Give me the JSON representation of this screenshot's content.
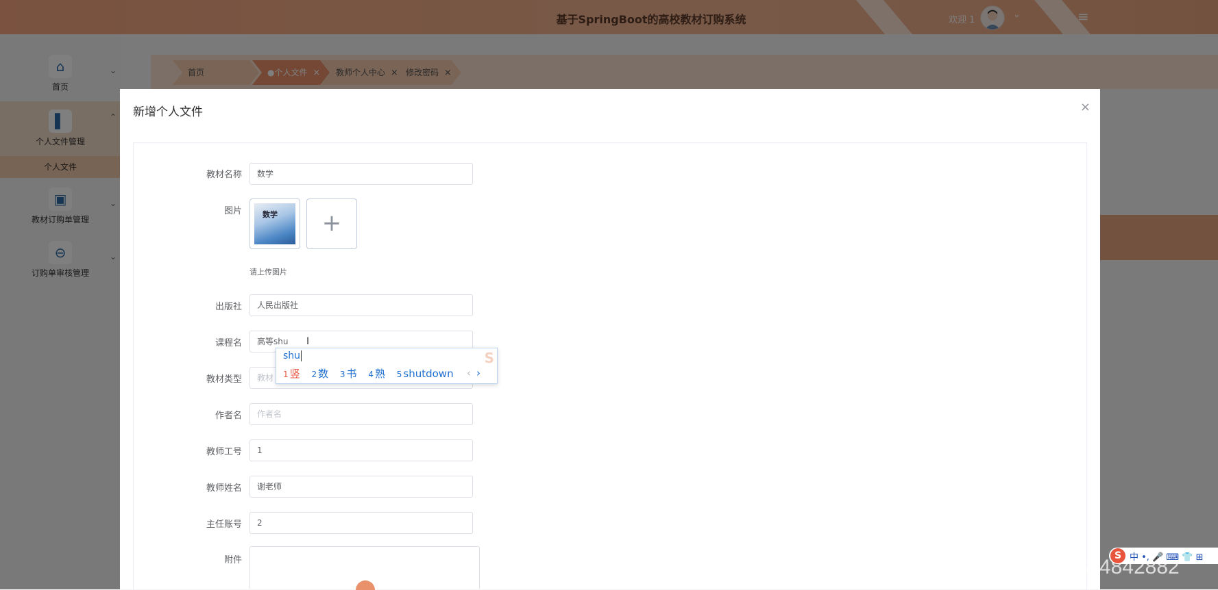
{
  "header": {
    "title": "基于SpringBoot的高校教材订购系统",
    "welcome": "欢迎 1",
    "chevron": "⌄",
    "menu_icon": "≡"
  },
  "sidebar": {
    "items": [
      {
        "label": "首页",
        "icon": "home-icon"
      },
      {
        "label": "个人文件管理",
        "icon": "file-panel-icon",
        "sub": "个人文件"
      },
      {
        "label": "教材订购单管理",
        "icon": "briefcase-icon"
      },
      {
        "label": "订购单审核管理",
        "icon": "audit-icon"
      }
    ]
  },
  "tabs": [
    {
      "label": "首页"
    },
    {
      "label": "●个人文件",
      "close": "×"
    },
    {
      "label": "教师个人中心",
      "close": "×"
    },
    {
      "label": "修改密码",
      "close": "×"
    }
  ],
  "dialog": {
    "title": "新增个人文件",
    "close": "×",
    "fields": {
      "textbook_name": {
        "label": "教材名称",
        "value": "数学"
      },
      "image": {
        "label": "图片",
        "hint": "请上传图片",
        "thumb_text": "数学",
        "plus": "+"
      },
      "publisher": {
        "label": "出版社",
        "value": "人民出版社"
      },
      "course": {
        "label": "课程名",
        "value": "高等shu"
      },
      "textbook_type": {
        "label": "教材类型",
        "placeholder": "教材"
      },
      "author": {
        "label": "作者名",
        "placeholder": "作者名"
      },
      "teacher_id": {
        "label": "教师工号",
        "value": "1"
      },
      "teacher_name": {
        "label": "教师姓名",
        "value": "谢老师"
      },
      "director_account": {
        "label": "主任账号",
        "value": "2"
      },
      "attachment": {
        "label": "附件"
      }
    }
  },
  "ime": {
    "composition": "shu",
    "candidates": [
      {
        "n": "1",
        "text": "竖"
      },
      {
        "n": "2",
        "text": "数"
      },
      {
        "n": "3",
        "text": "书"
      },
      {
        "n": "4",
        "text": "熟"
      },
      {
        "n": "5",
        "text": "shutdown"
      }
    ],
    "prev": "‹",
    "next": "›",
    "logo": "S",
    "toolbar": {
      "logo": "S",
      "mode": "中 •, 🎤 ⌨ 👕 ⊞"
    }
  },
  "watermark": "CSDN @qq_1394842882",
  "colors": {
    "header": "#f4a57f",
    "active_tab": "#e8916a",
    "accent_blue": "#1f6fd1"
  }
}
